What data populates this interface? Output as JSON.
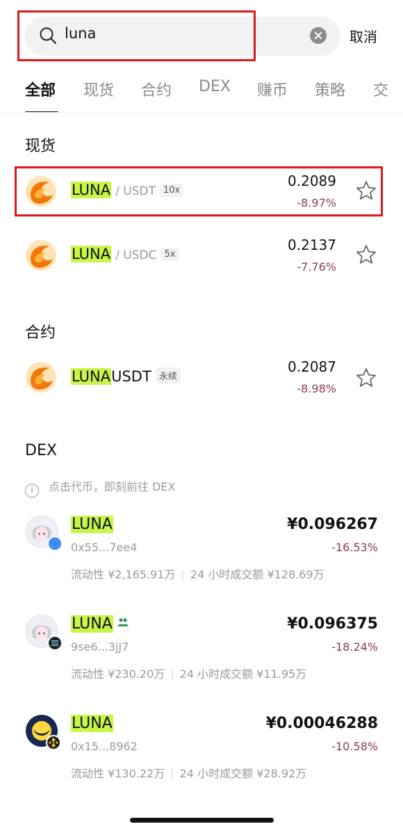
{
  "search": {
    "value": "luna",
    "cancel_label": "取消"
  },
  "tabs": [
    {
      "label": "全部",
      "active": true
    },
    {
      "label": "现货"
    },
    {
      "label": "合约"
    },
    {
      "label": "DEX"
    },
    {
      "label": "赚币"
    },
    {
      "label": "策略"
    },
    {
      "label": "交"
    }
  ],
  "spot": {
    "title": "现货",
    "items": [
      {
        "symbol": "LUNA",
        "quote": "/ USDT",
        "leverage": "10x",
        "price": "0.2089",
        "change": "-8.97%"
      },
      {
        "symbol": "LUNA",
        "quote": "/ USDC",
        "leverage": "5x",
        "price": "0.2137",
        "change": "-7.76%"
      }
    ]
  },
  "futures": {
    "title": "合约",
    "items": [
      {
        "symbol": "LUNA",
        "suffix": "USDT",
        "type": "永续",
        "price": "0.2087",
        "change": "-8.98%"
      }
    ]
  },
  "dex": {
    "title": "DEX",
    "info": "点击代币，即刻前往 DEX",
    "items": [
      {
        "symbol": "LUNA",
        "address": "0x55...7ee4",
        "liquidity": "流动性 ¥2,165.91万",
        "volume": "24 小时成交额 ¥128.69万",
        "price": "¥0.096267",
        "change": "-16.53%"
      },
      {
        "symbol": "LUNA",
        "address": "9se6...3jJ7",
        "liquidity": "流动性 ¥230.20万",
        "volume": "24 小时成交额 ¥11.95万",
        "price": "¥0.096375",
        "change": "-18.24%"
      },
      {
        "symbol": "LUNA",
        "address": "0x15...8962",
        "liquidity": "流动性 ¥130.22万",
        "volume": "24 小时成交额 ¥28.92万",
        "price": "¥0.00046288",
        "change": "-10.58%"
      }
    ]
  },
  "colors": {
    "highlight": "#c8f54a",
    "negative": "#8a3a52",
    "annotation_box": "#e0161b"
  }
}
